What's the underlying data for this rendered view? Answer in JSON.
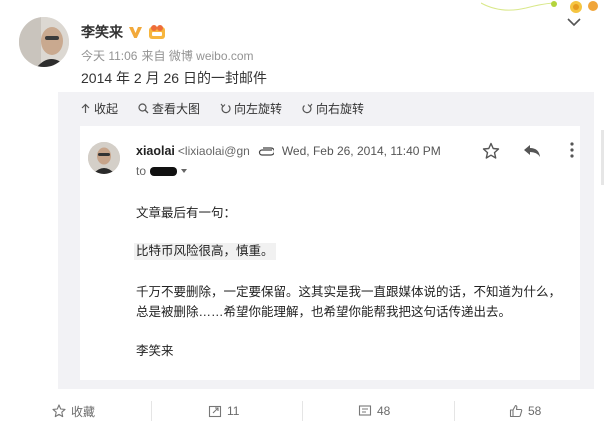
{
  "post": {
    "author": "李笑来",
    "time": "今天 11:06",
    "source": "来自 微博 weibo.com",
    "text": "2014 年 2 月 26 日的一封邮件"
  },
  "toolbar": {
    "collapse": "收起",
    "view_large": "查看大图",
    "rotate_left": "向左旋转",
    "rotate_right": "向右旋转"
  },
  "email": {
    "sender_name": "xiaolai",
    "sender_address": "<lixiaolai@gn",
    "date": "Wed, Feb 26, 2014, 11:40 PM",
    "to_label": "to",
    "line1": "文章最后有一句：",
    "line2": "比特币风险很高，慎重。",
    "line3": "千万不要删除，一定要保留。这其实是我一直跟媒体说的话，不知道为什么，总是被删除……希望你能理解，也希望你能帮我把这句话传递出去。",
    "signature": "李笑来"
  },
  "actions": {
    "favorite": "收藏",
    "repost_count": "11",
    "comment_count": "48",
    "like_count": "58"
  },
  "icons": {
    "verified": "verified-v-icon",
    "level": "level-badge-icon",
    "expand": "chevron-down-icon",
    "collapse": "arrow-up-icon",
    "zoom": "search-icon",
    "rotate_left": "rotate-left-icon",
    "rotate_right": "rotate-right-icon",
    "attachment": "paperclip-icon",
    "star": "star-icon",
    "reply": "reply-icon",
    "more": "more-vertical-icon",
    "repost": "repost-icon",
    "comment": "comment-icon",
    "like": "thumbs-up-icon"
  },
  "colors": {
    "verified": "#f2a93b",
    "link_gray": "#939393",
    "panel_bg": "#f2f2f5"
  }
}
